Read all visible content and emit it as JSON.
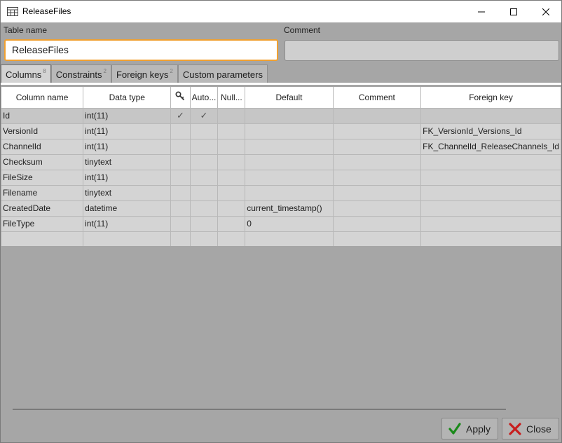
{
  "window": {
    "title": "ReleaseFiles"
  },
  "form": {
    "table_name_label": "Table name",
    "table_name_value": "ReleaseFiles",
    "comment_label": "Comment",
    "comment_value": ""
  },
  "tabs": [
    {
      "label": "Columns",
      "count": "8"
    },
    {
      "label": "Constraints",
      "count": "2"
    },
    {
      "label": "Foreign keys",
      "count": "2"
    },
    {
      "label": "Custom parameters",
      "count": ""
    }
  ],
  "grid": {
    "headers": [
      "Column name",
      "Data type",
      "",
      "Auto...",
      "Null...",
      "Default",
      "Comment",
      "Foreign key"
    ],
    "rows": [
      {
        "name": "Id",
        "type": "int(11)",
        "pk": "✓",
        "auto": "✓",
        "null": "",
        "default": "",
        "comment": "",
        "fk": ""
      },
      {
        "name": "VersionId",
        "type": "int(11)",
        "pk": "",
        "auto": "",
        "null": "",
        "default": "",
        "comment": "",
        "fk": "FK_VersionId_Versions_Id"
      },
      {
        "name": "ChannelId",
        "type": "int(11)",
        "pk": "",
        "auto": "",
        "null": "",
        "default": "",
        "comment": "",
        "fk": "FK_ChannelId_ReleaseChannels_Id"
      },
      {
        "name": "Checksum",
        "type": "tinytext",
        "pk": "",
        "auto": "",
        "null": "",
        "default": "",
        "comment": "",
        "fk": ""
      },
      {
        "name": "FileSize",
        "type": "int(11)",
        "pk": "",
        "auto": "",
        "null": "",
        "default": "",
        "comment": "",
        "fk": ""
      },
      {
        "name": "Filename",
        "type": "tinytext",
        "pk": "",
        "auto": "",
        "null": "",
        "default": "",
        "comment": "",
        "fk": ""
      },
      {
        "name": "CreatedDate",
        "type": "datetime",
        "pk": "",
        "auto": "",
        "null": "",
        "default": "current_timestamp()",
        "comment": "",
        "fk": ""
      },
      {
        "name": "FileType",
        "type": "int(11)",
        "pk": "",
        "auto": "",
        "null": "",
        "default": "0",
        "comment": "",
        "fk": ""
      }
    ]
  },
  "footer": {
    "apply_label": "Apply",
    "close_label": "Close"
  },
  "colors": {
    "accent_focus": "#f0a030",
    "apply_icon": "#1a8a1a",
    "close_icon": "#c81e1e"
  }
}
